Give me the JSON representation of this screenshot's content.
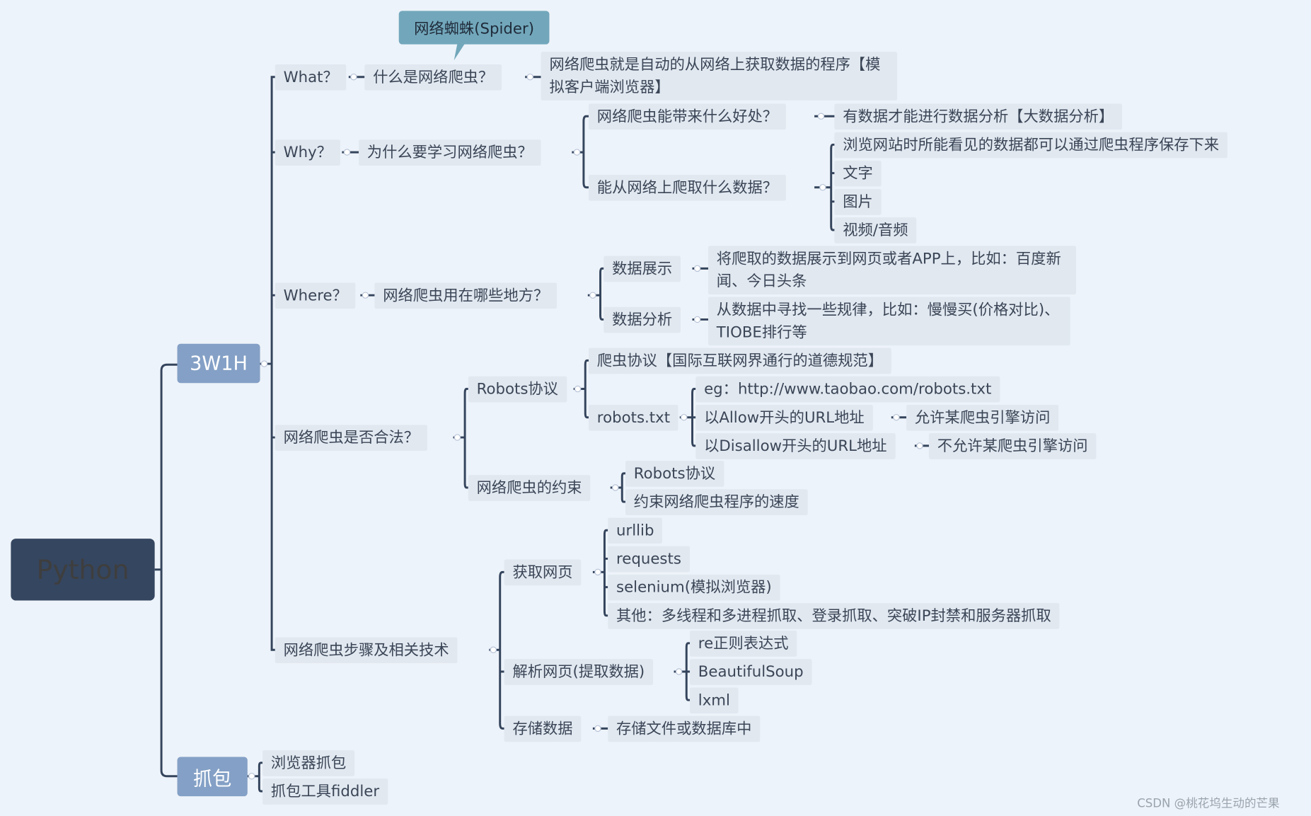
{
  "root": "Python",
  "main": {
    "w3h1": "3W1H",
    "capture": "抓包"
  },
  "callout": "网络蜘蛛(Spider)",
  "what": {
    "label": "What？",
    "question": "什么是网络爬虫？",
    "answer": "网络爬虫就是自动的从网络上获取数据的程序【模拟客户端浏览器】"
  },
  "why": {
    "label": "Why？",
    "question": "为什么要学习网络爬虫？",
    "benefit": "网络爬虫能带来什么好处？",
    "benefit_answer": "有数据才能进行数据分析【大数据分析】",
    "data": "能从网络上爬取什么数据？",
    "data_items": [
      "浏览网站时所能看见的数据都可以通过爬虫程序保存下来",
      "文字",
      "图片",
      "视频/音频"
    ]
  },
  "where": {
    "label": "Where？",
    "question": "网络爬虫用在哪些地方？",
    "display": "数据展示",
    "display_answer": "将爬取的数据展示到网页或者APP上，比如：百度新闻、今日头条",
    "analysis": "数据分析",
    "analysis_answer": "从数据中寻找一些规律，比如：慢慢买(价格对比)、TIOBE排行等"
  },
  "legal": {
    "label": "网络爬虫是否合法？",
    "robots": "Robots协议",
    "robots_desc": "爬虫协议【国际互联网界通行的道德规范】",
    "robots_txt": "robots.txt",
    "eg": "eg：http://www.taobao.com/robots.txt",
    "allow": "以Allow开头的URL地址",
    "allow_desc": "允许某爬虫引擎访问",
    "disallow": "以Disallow开头的URL地址",
    "disallow_desc": "不允许某爬虫引擎访问",
    "constraint": "网络爬虫的约束",
    "constraint_items": [
      "Robots协议",
      "约束网络爬虫程序的速度"
    ]
  },
  "steps": {
    "label": "网络爬虫步骤及相关技术",
    "fetch": "获取网页",
    "fetch_items": [
      "urllib",
      "requests",
      "selenium(模拟浏览器)",
      "其他：多线程和多进程抓取、登录抓取、突破IP封禁和服务器抓取"
    ],
    "parse": "解析网页(提取数据)",
    "parse_items": [
      "re正则表达式",
      "BeautifulSoup",
      "lxml"
    ],
    "store": "存储数据",
    "store_item": "存储文件或数据库中"
  },
  "capture": {
    "items": [
      "浏览器抓包",
      "抓包工具fiddler"
    ]
  },
  "watermark": "CSDN @桃花坞生动的芒果",
  "colors": {
    "background": "#edf3fa",
    "root": "#354660",
    "main": "#84a0c6",
    "callout": "#72a7bb",
    "node": "#e1e8f0",
    "line": "#34445c"
  }
}
